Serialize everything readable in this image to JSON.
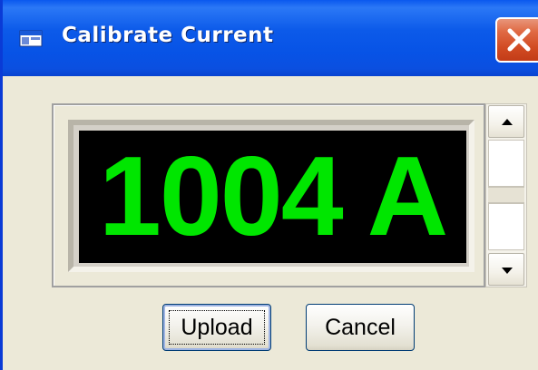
{
  "window": {
    "title": "Calibrate Current",
    "title_icon": "app-window-icon",
    "close_icon": "close-icon"
  },
  "display": {
    "value": "1004 A",
    "text_color": "#00e600",
    "background_color": "#000000"
  },
  "spinner": {
    "up_icon": "arrow-up-icon",
    "down_icon": "arrow-down-icon"
  },
  "buttons": {
    "upload_label": "Upload",
    "cancel_label": "Cancel"
  },
  "colors": {
    "titlebar": "#0a58ee",
    "close": "#d14a22",
    "dialog_bg": "#ece9d8"
  }
}
